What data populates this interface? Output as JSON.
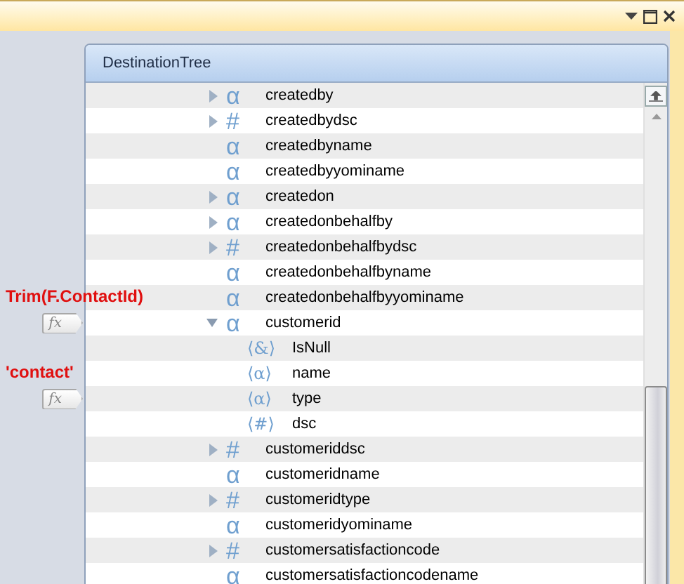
{
  "panel": {
    "title": "DestinationTree"
  },
  "tree": [
    {
      "name": "createdby",
      "icon": "α",
      "expandable": true,
      "expanded": false
    },
    {
      "name": "createdbydsc",
      "icon": "#",
      "expandable": true,
      "expanded": false
    },
    {
      "name": "createdbyname",
      "icon": "α",
      "expandable": false
    },
    {
      "name": "createdbyyominame",
      "icon": "α",
      "expandable": false
    },
    {
      "name": "createdon",
      "icon": "α",
      "expandable": true,
      "expanded": false
    },
    {
      "name": "createdonbehalfby",
      "icon": "α",
      "expandable": true,
      "expanded": false
    },
    {
      "name": "createdonbehalfbydsc",
      "icon": "#",
      "expandable": true,
      "expanded": false
    },
    {
      "name": "createdonbehalfbyname",
      "icon": "α",
      "expandable": false
    },
    {
      "name": "createdonbehalfbyyominame",
      "icon": "α",
      "expandable": false
    },
    {
      "name": "customerid",
      "icon": "α",
      "expandable": true,
      "expanded": true,
      "mapping": {
        "expression": "Trim(F.ContactId)",
        "badge": "fx"
      },
      "children": [
        {
          "name": "IsNull",
          "icon": "⟨&⟩",
          "expandable": false
        },
        {
          "name": "name",
          "icon": "⟨α⟩",
          "expandable": false
        },
        {
          "name": "type",
          "icon": "⟨α⟩",
          "expandable": false,
          "mapping": {
            "expression": "'contact'",
            "badge": "fx"
          }
        },
        {
          "name": "dsc",
          "icon": "⟨#⟩",
          "expandable": false
        }
      ]
    },
    {
      "name": "customeriddsc",
      "icon": "#",
      "expandable": true,
      "expanded": false
    },
    {
      "name": "customeridname",
      "icon": "α",
      "expandable": false
    },
    {
      "name": "customeridtype",
      "icon": "#",
      "expandable": true,
      "expanded": false
    },
    {
      "name": "customeridyominame",
      "icon": "α",
      "expandable": false
    },
    {
      "name": "customersatisfactioncode",
      "icon": "#",
      "expandable": true,
      "expanded": false
    },
    {
      "name": "customersatisfactioncodename",
      "icon": "α",
      "expandable": false
    }
  ]
}
